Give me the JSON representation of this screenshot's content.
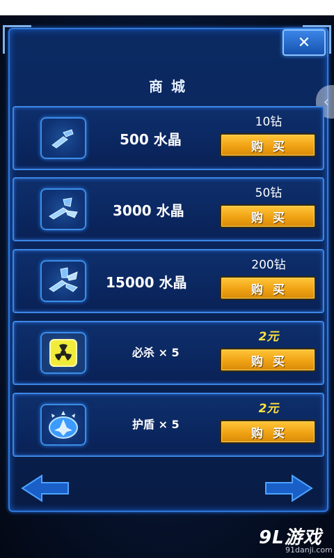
{
  "window": {
    "close_label": "✕",
    "side_tab_label": "‹"
  },
  "shop": {
    "title": "商城",
    "buy_label": "购买"
  },
  "items": [
    {
      "name": "500  水晶",
      "price": "10钻",
      "price_type": "diamond",
      "icon": "crystal-small-icon"
    },
    {
      "name": "3000 水晶",
      "price": "50钻",
      "price_type": "diamond",
      "icon": "crystal-medium-icon"
    },
    {
      "name": "15000 水晶",
      "price": "200钻",
      "price_type": "diamond",
      "icon": "crystal-large-icon"
    },
    {
      "name": "必杀 × 5",
      "price": "2元",
      "price_type": "yuan",
      "icon": "radiation-bomb-icon"
    },
    {
      "name": "护盾 × 5",
      "price": "2元",
      "price_type": "yuan",
      "icon": "shield-fighter-icon"
    }
  ],
  "nav": {
    "prev_icon": "arrow-left-icon",
    "next_icon": "arrow-right-icon"
  },
  "watermark": {
    "main": "9L游戏",
    "sub": "91danji.com"
  },
  "colors": {
    "panel": "#0b2a63",
    "border": "#3d86e4",
    "buy_button": "#f0a214",
    "yuan_price": "#ffe23d"
  }
}
